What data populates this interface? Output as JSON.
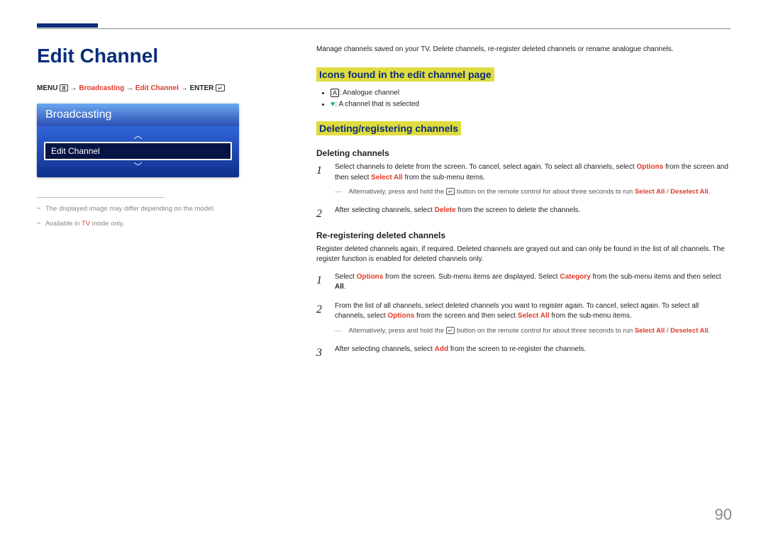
{
  "page_title": "Edit Channel",
  "breadcrumb": {
    "menu": "MENU",
    "arrow": "→",
    "broadcasting": "Broadcasting",
    "edit_channel": "Edit Channel",
    "enter": "ENTER"
  },
  "tv_widget": {
    "header": "Broadcasting",
    "selected": "Edit Channel"
  },
  "footnotes": {
    "f1_a": "The displayed image may differ depending on the model.",
    "f2_a": "Available in ",
    "f2_b": "TV",
    "f2_c": " mode only."
  },
  "intro": "Manage channels saved on your TV. Delete channels, re-register deleted channels or rename analogue channels.",
  "h_icons": "Icons found in the edit channel page",
  "icons": {
    "a_label": "A",
    "a_text": ": Analogue channel",
    "heart_text": ": A channel that is selected"
  },
  "h_delreg": "Deleting/registering channels",
  "h_deleting": "Deleting channels",
  "del_step1": {
    "a": "Select channels to delete from the screen. To cancel, select again. To select all channels, select ",
    "b": "Options",
    "c": " from the screen and then select ",
    "d": "Select All",
    "e": " from the sub-menu items.",
    "note_a": "Alternatively, press and hold the ",
    "note_b": " button on the remote control for about three seconds to run ",
    "note_c": "Select All",
    "note_d": " / ",
    "note_e": "Deselect All",
    "note_f": "."
  },
  "del_step2": {
    "a": "After selecting channels, select ",
    "b": "Delete",
    "c": " from the screen to delete the channels."
  },
  "h_rereg": "Re-registering deleted channels",
  "rereg_intro": "Register deleted channels again, if required. Deleted channels are grayed out and can only be found in the list of all channels. The register function is enabled for deleted channels only.",
  "rr_step1": {
    "a": "Select ",
    "b": "Options",
    "c": " from the screen. Sub-menu items are displayed. Select ",
    "d": "Category",
    "e": " from the sub-menu items and then select ",
    "f": "All",
    "g": "."
  },
  "rr_step2": {
    "a": "From the list of all channels, select deleted channels you want to register again. To cancel, select again. To select all channels, select ",
    "b": "Options",
    "c": " from the screen and then select ",
    "d": "Select All",
    "e": " from the sub-menu items.",
    "note_a": "Alternatively, press and hold the ",
    "note_b": " button on the remote control for about three seconds to run ",
    "note_c": "Select All",
    "note_d": " / ",
    "note_e": "Deselect All",
    "note_f": "."
  },
  "rr_step3": {
    "a": "After selecting channels, select ",
    "b": "Add",
    "c": " from the screen to re-register the channels."
  },
  "nums": {
    "n1": "1",
    "n2": "2",
    "n3": "3"
  },
  "page_number": "90"
}
